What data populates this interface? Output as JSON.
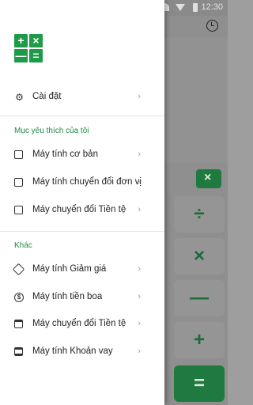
{
  "status_bar": {
    "time": "12:30"
  },
  "calculator": {
    "backspace_icon": "×",
    "ops": {
      "divide": "÷",
      "multiply": "×",
      "minus": "—",
      "plus": "+",
      "equals": "="
    }
  },
  "drawer": {
    "logo": {
      "tl": "+",
      "tr": "×",
      "bl": "—",
      "br": "="
    },
    "settings": {
      "label": "Cài đặt",
      "icon": "gear-icon"
    },
    "favorites_header": "Mục yêu thích của tôi",
    "favorites": [
      {
        "label": "Máy tính cơ bản",
        "icon": "calculator-icon"
      },
      {
        "label": "Máy tính chuyển đổi đơn vị",
        "icon": "unit-converter-icon"
      },
      {
        "label": "Máy chuyển đổi Tiền tệ",
        "icon": "currency-converter-icon"
      }
    ],
    "other_header": "Khác",
    "others": [
      {
        "label": "Máy tính Giảm giá",
        "icon": "discount-tag-icon"
      },
      {
        "label": "Máy tính tiền boa",
        "icon": "dollar-icon"
      },
      {
        "label": "Máy chuyển đổi Tiền tệ",
        "icon": "calendar-icon"
      },
      {
        "label": "Máy tính Khoản vay",
        "icon": "bank-icon"
      }
    ],
    "chevron": "›"
  },
  "colors": {
    "accent": "#1e9a48",
    "accent_dark": "#1e7a3e"
  }
}
